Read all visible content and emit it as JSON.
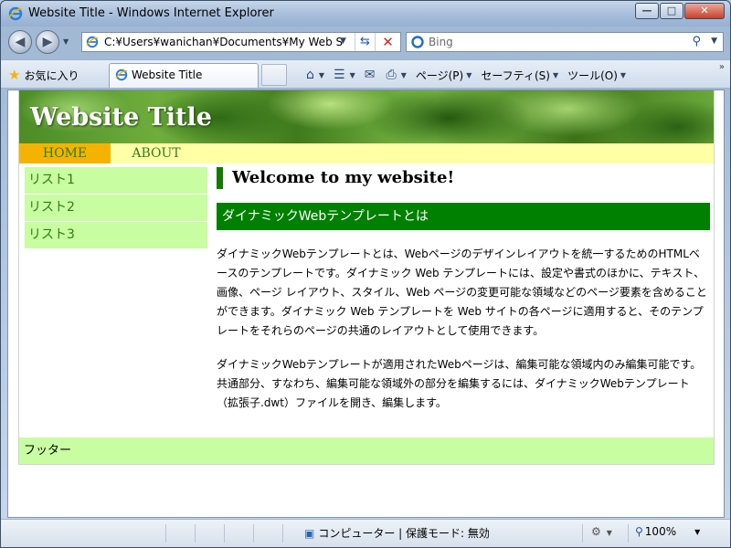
{
  "window": {
    "title": "Website Title - Windows Internet Explorer",
    "min_glyph": "—",
    "max_glyph": "□",
    "close_glyph": "✕"
  },
  "address_bar": {
    "url": "C:¥Users¥wanichan¥Documents¥My Web S",
    "search_placeholder": "Bing"
  },
  "favorites": {
    "label": "お気に入り"
  },
  "tab": {
    "label": "Website Title"
  },
  "command_bar": {
    "page_label": "ページ(P)",
    "safety_label": "セーフティ(S)",
    "tools_label": "ツール(O)"
  },
  "site": {
    "title": "Website Title",
    "nav": [
      "HOME",
      "ABOUT"
    ],
    "sidebar": [
      "リスト1",
      "リスト2",
      "リスト3"
    ],
    "heading": "Welcome to my website!",
    "subheading": "ダイナミックWebテンプレートとは",
    "paragraphs": [
      "ダイナミックWebテンプレートとは、Webページのデザインレイアウトを統一するためのHTMLベースのテンプレートです。ダイナミック Web テンプレートには、設定や書式のほかに、テキスト、画像、ページ レイアウト、スタイル、Web ページの変更可能な領域などのページ要素を含めることができます。ダイナミック Web テンプレートを Web サイトの各ページに適用すると、そのテンプレートをそれらのページの共通のレイアウトとして使用できます。",
      "ダイナミックWebテンプレートが適用されたWebページは、編集可能な領域内のみ編集可能です。共通部分、すなわち、編集可能な領域外の部分を編集するには、ダイナミックWebテンプレート（拡張子.dwt）ファイルを開き、編集します。"
    ],
    "footer": "フッター"
  },
  "status_bar": {
    "zone": "コンピューター | 保護モード: 無効",
    "zoom": "100%"
  },
  "colors": {
    "nav_home_bg": "#f4b300",
    "nav_bg": "#ffffa6",
    "sidebar_bg": "#c9fda2",
    "accent_green": "#008000",
    "link_green": "#2e7d1a"
  }
}
